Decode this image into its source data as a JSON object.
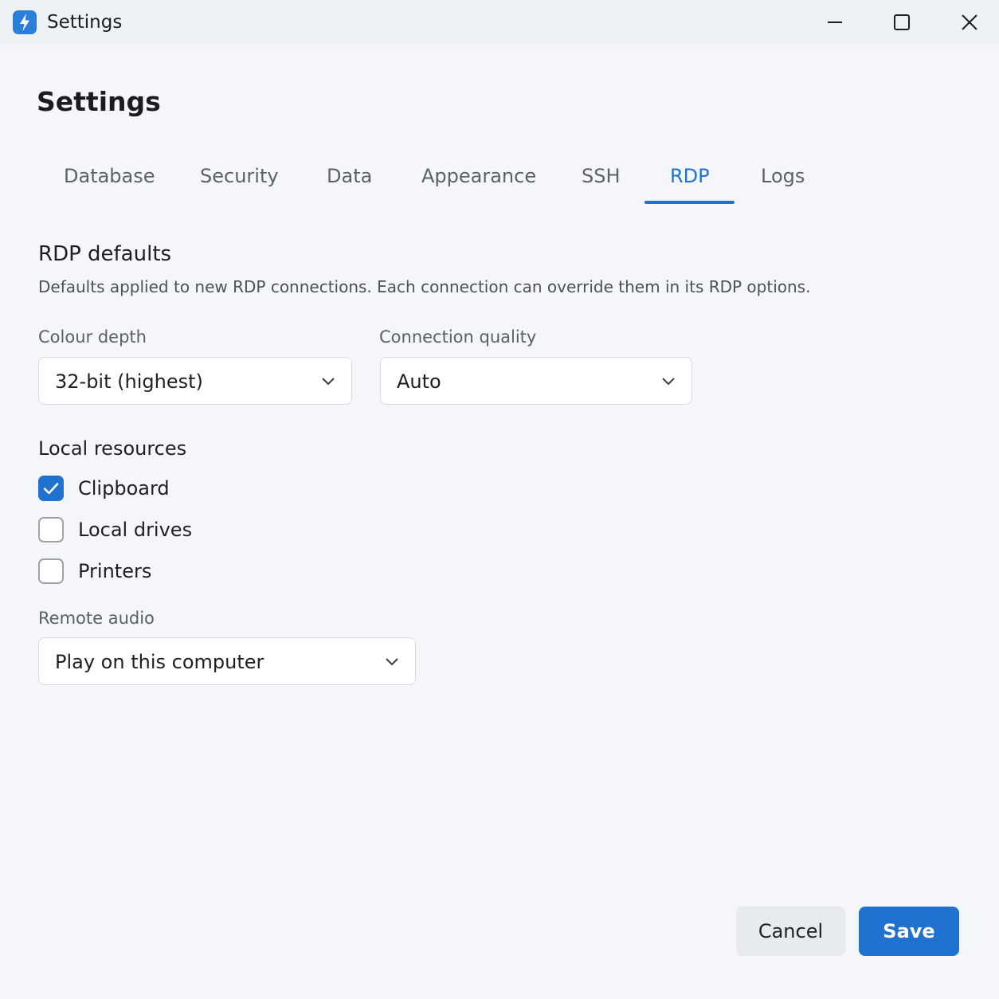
{
  "window": {
    "title": "Settings",
    "app_icon": "lightning-bolt-icon",
    "controls": [
      "minimize-icon",
      "maximize-icon",
      "close-icon"
    ]
  },
  "page": {
    "title": "Settings"
  },
  "tabs": [
    {
      "label": "Database",
      "active": false
    },
    {
      "label": "Security",
      "active": false
    },
    {
      "label": "Data",
      "active": false
    },
    {
      "label": "Appearance",
      "active": false
    },
    {
      "label": "SSH",
      "active": false
    },
    {
      "label": "RDP",
      "active": true
    },
    {
      "label": "Logs",
      "active": false
    }
  ],
  "rdp": {
    "section_title": "RDP defaults",
    "section_description": "Defaults applied to new RDP connections. Each connection can override them in its RDP options.",
    "colour_depth": {
      "label": "Colour depth",
      "value": "32-bit (highest)"
    },
    "connection_quality": {
      "label": "Connection quality",
      "value": "Auto"
    },
    "local_resources": {
      "heading": "Local resources",
      "items": [
        {
          "label": "Clipboard",
          "checked": true
        },
        {
          "label": "Local drives",
          "checked": false
        },
        {
          "label": "Printers",
          "checked": false
        }
      ]
    },
    "remote_audio": {
      "label": "Remote audio",
      "value": "Play on this computer"
    }
  },
  "footer": {
    "cancel_label": "Cancel",
    "save_label": "Save"
  },
  "colors": {
    "accent": "#1f72d0",
    "background": "#f4f6f9",
    "titlebar": "#eef1f6"
  }
}
